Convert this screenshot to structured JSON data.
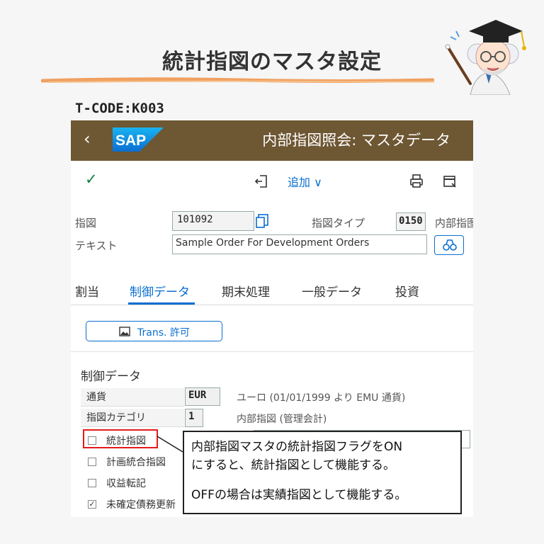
{
  "header": {
    "title": "統計指図のマスタ設定",
    "tcode": "T-CODE:K003"
  },
  "shell": {
    "back_icon": "chevron-left-icon",
    "logo_text": "SAP",
    "title": "内部指図照会: マスタデータ",
    "bar_color": "#6e5733"
  },
  "toolbar": {
    "add_label": "追加 ∨",
    "accent": "#0a6ed1"
  },
  "form": {
    "order_label": "指図",
    "order_value": "101092",
    "order_type_label": "指図タイプ",
    "order_type_value": "0150",
    "order_type_desc": "内部指图",
    "text_label": "テキスト",
    "text_value": "Sample Order For Development Orders"
  },
  "tabs": [
    {
      "label": "割当"
    },
    {
      "label": "制御データ",
      "active": true
    },
    {
      "label": "期末処理"
    },
    {
      "label": "一般データ"
    },
    {
      "label": "投資"
    }
  ],
  "trans_button": {
    "label": "Trans. 許可"
  },
  "control": {
    "section_title": "制御データ",
    "currency_label": "通貨",
    "currency_value": "EUR",
    "currency_desc": "ユーロ (01/01/1999 より EMU 通貨)",
    "category_label": "指図カテゴリ",
    "category_value": "1",
    "category_desc": "内部指図 (管理会計)",
    "checkboxes": [
      {
        "label": "統計指図",
        "checked": false
      },
      {
        "label": "計画統合指図",
        "checked": false
      },
      {
        "label": "収益転記",
        "checked": false
      },
      {
        "label": "未確定債務更新",
        "checked": true
      }
    ]
  },
  "callout": {
    "line1": "内部指図マスタの統計指図フラグをON",
    "line2": "にすると、統計指図として機能する。",
    "line3": "OFFの場合は実績指図として機能する。"
  },
  "colors": {
    "highlight": "#e31b1b",
    "underline": "#f0a060"
  }
}
